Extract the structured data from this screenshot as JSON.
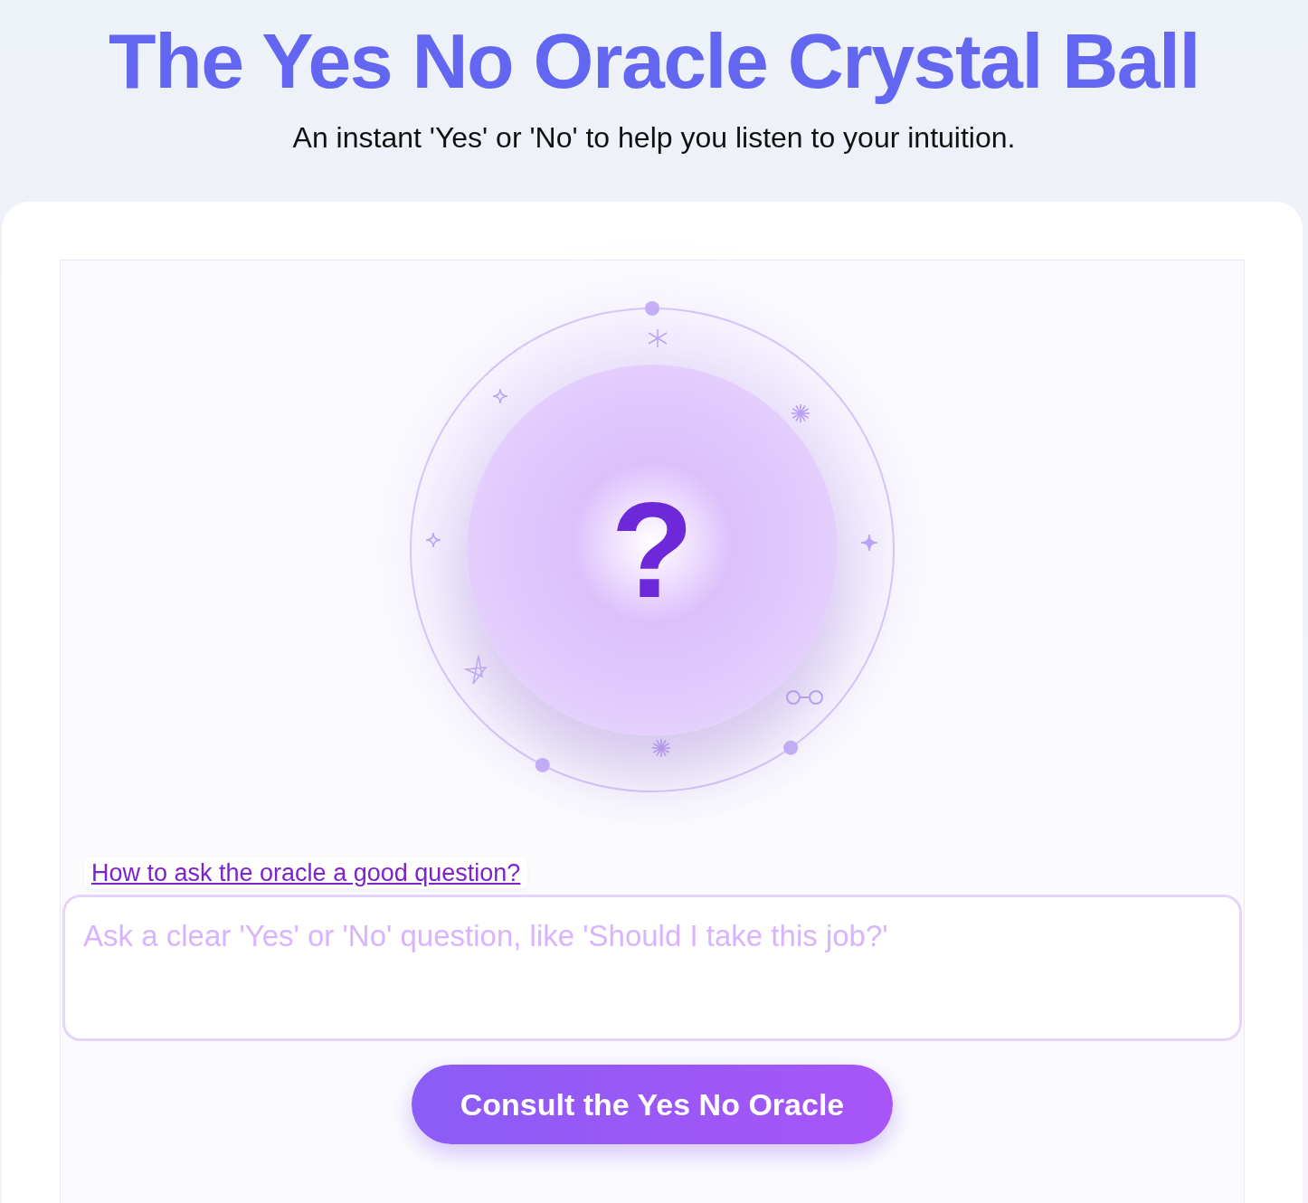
{
  "header": {
    "title": "The Yes No Oracle Crystal Ball",
    "subtitle": "An instant 'Yes' or 'No' to help you listen to your intuition."
  },
  "oracle": {
    "symbol": "?"
  },
  "help_link": "How to ask the oracle a good question?",
  "question_field": {
    "placeholder": "Ask a clear 'Yes' or 'No' question, like 'Should I take this job?'"
  },
  "submit_button": "Consult the Yes No Oracle"
}
